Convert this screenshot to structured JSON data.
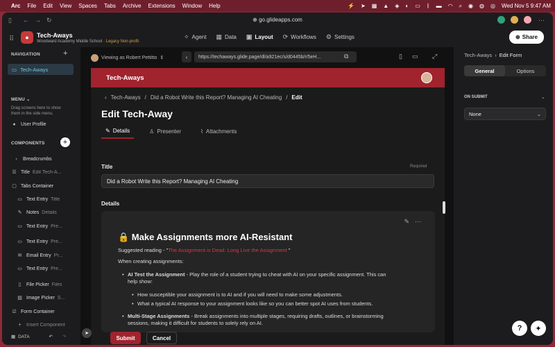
{
  "menubar": {
    "app": "Arc",
    "items": [
      "File",
      "Edit",
      "View",
      "Spaces",
      "Tabs",
      "Archive",
      "Extensions",
      "Window",
      "Help"
    ],
    "datetime": "Wed Nov 5  9:47 AM"
  },
  "browser": {
    "url": "go.glideapps.com"
  },
  "app_header": {
    "name": "Tech-Aways",
    "school": "Woodward Academy Middle School",
    "plan": "Legacy Non-profit",
    "nav": [
      {
        "label": "Agent",
        "icon": "agent-icon"
      },
      {
        "label": "Data",
        "icon": "table-icon"
      },
      {
        "label": "Layout",
        "icon": "layout-icon"
      },
      {
        "label": "Workflows",
        "icon": "workflow-icon"
      },
      {
        "label": "Settings",
        "icon": "gear-icon"
      }
    ],
    "share_label": "Share"
  },
  "left_sidebar": {
    "navigation_title": "NAVIGATION",
    "nav_active": "Tech-Aways",
    "menu_title": "MENU",
    "menu_hint": "Drag screens here to show them in the side menu.",
    "menu_item": "User Profile",
    "components_title": "COMPONENTS",
    "components": [
      {
        "icon": "chevron-right-icon",
        "label": "Breadcrumbs",
        "value": ""
      },
      {
        "icon": "title-icon",
        "label": "Title",
        "value": "Edit Tech-A..."
      },
      {
        "icon": "folder-icon",
        "label": "Tabs Container",
        "value": ""
      },
      {
        "icon": "text-entry-icon",
        "label": "Text Entry",
        "value": "Title"
      },
      {
        "icon": "notes-icon",
        "label": "Notes",
        "value": "Details"
      },
      {
        "icon": "text-entry-icon",
        "label": "Text Entry",
        "value": "Pre..."
      },
      {
        "icon": "text-entry-icon",
        "label": "Text Entry",
        "value": "Pre..."
      },
      {
        "icon": "email-icon",
        "label": "Email Entry",
        "value": "Pr..."
      },
      {
        "icon": "text-entry-icon",
        "label": "Text Entry",
        "value": "Pre..."
      },
      {
        "icon": "file-icon",
        "label": "File Picker",
        "value": "Files"
      },
      {
        "icon": "image-icon",
        "label": "Image Picker",
        "value": "S..."
      },
      {
        "icon": "form-icon",
        "label": "Form Container",
        "value": ""
      },
      {
        "icon": "plus-icon",
        "label": "Insert Component",
        "value": ""
      }
    ],
    "data_label": "DATA"
  },
  "canvas": {
    "viewing_as": "Viewing as Robert Pettitto",
    "preview_url": "https://techaways.glide.page/dl/a921ec/s/d0445b/r/5eH..."
  },
  "preview": {
    "app_title": "Tech-Aways",
    "breadcrumb": [
      "Tech-Aways",
      "Did a Robot Write this Report? Managing AI Cheating",
      "Edit"
    ],
    "page_title": "Edit Tech-Away",
    "tabs": [
      {
        "label": "Details",
        "icon": "pencil-square-icon"
      },
      {
        "label": "Presenter",
        "icon": "person-icon"
      },
      {
        "label": "Attachments",
        "icon": "paperclip-icon"
      }
    ],
    "title_label": "Title",
    "required_label": "Required",
    "title_value": "Did a Robot Write this Report? Managing AI Cheating",
    "details_label": "Details",
    "details": {
      "heading": "🔒 Make Assignments more AI-Resistant",
      "suggested_prefix": "Suggested reading - \"",
      "suggested_link": "The Assignment is Dead. Long Live the Assignment",
      "suggested_suffix": " \"",
      "intro": "When creating assignments:",
      "bullet1_bold": "AI Test the Assignment",
      "bullet1_text": " - Play the role of a student trying to cheat with AI on your specific assignment. This can",
      "bullet1_cont": "help show:",
      "sub1": "How susceptible your assignment is to AI and if you will need to make some adjustments.",
      "sub2": "What a typical AI response to your assignment looks like so you can better spot AI uses from students.",
      "bullet2_bold": "Multi-Stage Assignments",
      "bullet2_text": " - Break assignments into multiple stages, requiring drafts, outlines, or brainstorming",
      "bullet2_cont": "sessions, making it difficult for students to solely rely on AI."
    },
    "submit_label": "Submit",
    "cancel_label": "Cancel"
  },
  "right_panel": {
    "breadcrumb": [
      "Tech-Aways",
      "Edit Form"
    ],
    "tabs": [
      "General",
      "Options"
    ],
    "on_submit_label": "ON SUBMIT",
    "on_submit_value": "None"
  }
}
